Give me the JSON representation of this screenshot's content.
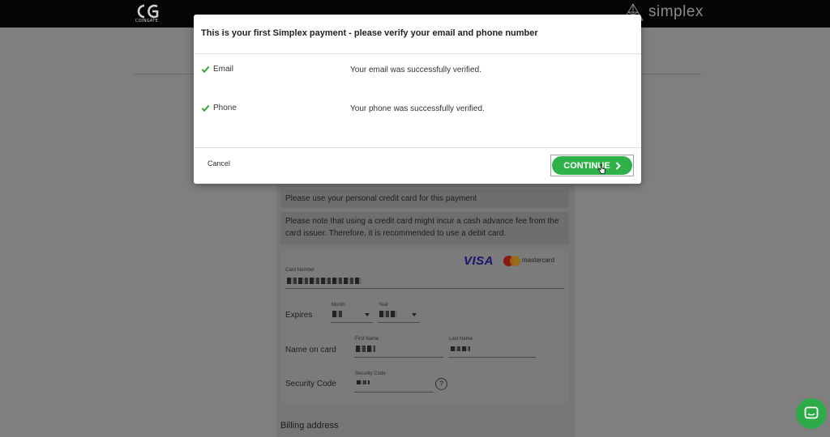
{
  "header": {
    "left_logo_text": "COINGATE",
    "right_logo_text": "simplex"
  },
  "form": {
    "notice_personal": "Please use your personal credit card for this payment",
    "notice_fee": "Please note that using a credit card might incur a cash advance fee from the card issuer. Therefore, it is recommended to use a debit card.",
    "visa_label": "VISA",
    "mastercard_label": "mastercard",
    "card_number_label": "Card Number",
    "expires_label": "Expires",
    "month_label": "Month",
    "year_label": "Year",
    "name_on_card_label": "Name on card",
    "first_name_label": "First Name",
    "last_name_label": "Last Name",
    "security_code_label": "Security Code",
    "security_code_small_label": "Security Code",
    "help_symbol": "?",
    "billing_address_label": "Billing address"
  },
  "modal": {
    "title": "This is your first Simplex payment - please verify your email and phone number",
    "rows": [
      {
        "label": "Email",
        "message": "Your email was successfully verified."
      },
      {
        "label": "Phone",
        "message": "Your phone was successfully verified."
      }
    ],
    "cancel_label": "Cancel",
    "continue_label": "CONTINUE"
  },
  "colors": {
    "accent_green": "#2fb14a",
    "check_green": "#3aa53f",
    "header_bg": "#050505"
  },
  "icons": {
    "check": "check-icon",
    "continue_arrow": "chevron-right-icon",
    "chat": "chat-icon"
  }
}
